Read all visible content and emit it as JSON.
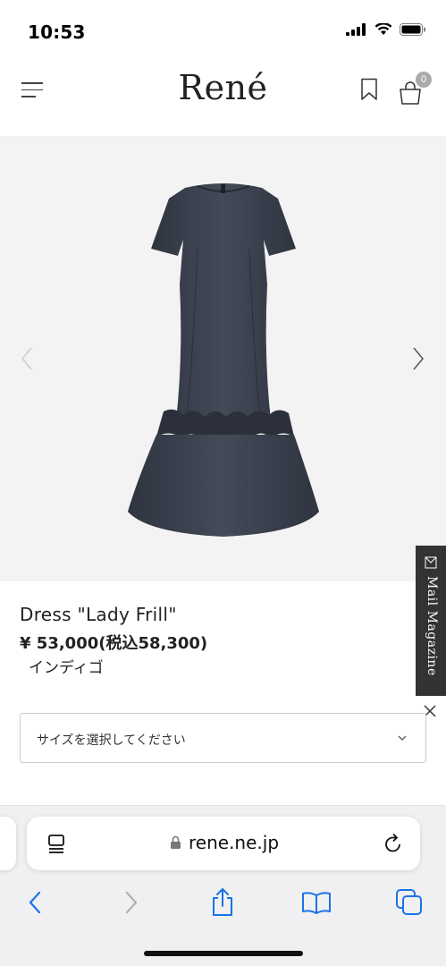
{
  "status_bar": {
    "time": "10:53"
  },
  "header": {
    "logo": "René",
    "cart_count": "0"
  },
  "product": {
    "name": "Dress \"Lady Frill\"",
    "price": "¥ 53,000(税込58,300)",
    "color": "インディゴ",
    "size_placeholder": "サイズを選択してください"
  },
  "side_tab": {
    "label": "Mail Magazine"
  },
  "browser": {
    "url": "rene.ne.jp"
  },
  "icons": {
    "menu": "hamburger-icon",
    "bookmark": "bookmark-icon",
    "cart": "shopping-bag-icon",
    "prev": "chevron-left-icon",
    "next": "chevron-right-icon",
    "mail": "mail-icon",
    "close": "close-icon",
    "dropdown": "chevron-down-icon",
    "tabs": "tab-overview-icon",
    "lock": "lock-icon",
    "reload": "reload-icon",
    "back": "back-icon",
    "forward": "forward-icon",
    "share": "share-icon",
    "bookmarks": "book-icon",
    "all_tabs": "tabs-icon"
  },
  "colors": {
    "accent": "#1a73e8",
    "dress": "#3a404d",
    "mail_tab_bg": "#333333"
  }
}
